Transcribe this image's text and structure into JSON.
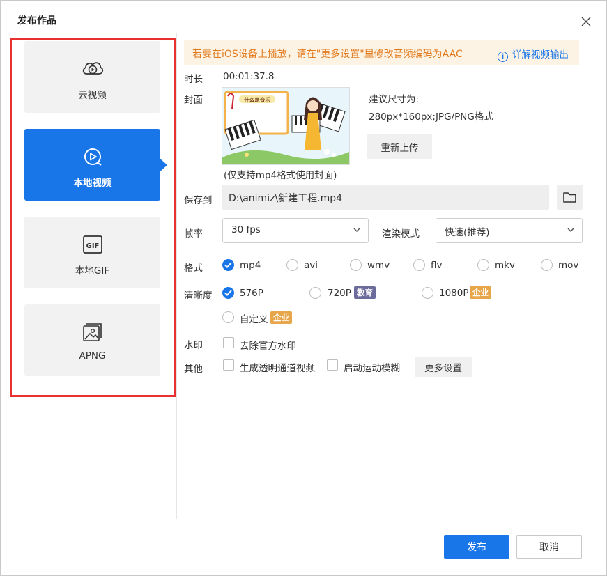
{
  "dialog": {
    "title": "发布作品"
  },
  "sidebar": {
    "items": [
      {
        "label": "云视频",
        "icon": "cloud-video-icon",
        "active": false
      },
      {
        "label": "本地视频",
        "icon": "local-video-icon",
        "active": true
      },
      {
        "label": "本地GIF",
        "icon": "gif-icon",
        "active": false
      },
      {
        "label": "APNG",
        "icon": "apng-icon",
        "active": false
      }
    ],
    "gif_icon_text": "GIF"
  },
  "notice": {
    "text": "若要在iOS设备上播放，请在\"更多设置\"里修改音频编码为AAC",
    "link": "详解视频输出",
    "info_glyph": "i"
  },
  "duration": {
    "label": "时长",
    "value": "00:01:37.8"
  },
  "cover": {
    "label": "封面",
    "hint_line1": "建议尺寸为:",
    "hint_line2": "280px*160px;JPG/PNG格式",
    "reupload": "重新上传",
    "note": "(仅支持mp4格式使用封面)",
    "thumb_title": "什么是音乐"
  },
  "save_to": {
    "label": "保存到",
    "path": "D:\\animiz\\新建工程.mp4"
  },
  "frame_rate": {
    "label": "帧率",
    "value": "30 fps"
  },
  "render_mode": {
    "label": "渲染模式",
    "value": "快速(推荐)"
  },
  "format": {
    "label": "格式",
    "options": [
      "mp4",
      "avi",
      "wmv",
      "flv",
      "mkv",
      "mov"
    ],
    "selected": "mp4"
  },
  "resolution": {
    "label": "清晰度",
    "options": [
      "576P",
      "720P",
      "1080P",
      "自定义"
    ],
    "selected": "576P",
    "badge_edu": "教育",
    "badge_ent": "企业"
  },
  "watermark": {
    "label": "水印",
    "option": "去除官方水印"
  },
  "other": {
    "label": "其他",
    "transparent": "生成透明通道视频",
    "motion_blur": "启动运动模糊",
    "more_settings": "更多设置"
  },
  "footer": {
    "publish": "发布",
    "cancel": "取消"
  },
  "colors": {
    "accent": "#1976e8",
    "notice_text": "#e27a1c",
    "outline": "#e8302e",
    "badge_edu": "#6b6b9c",
    "badge_ent": "#e7a64a"
  }
}
